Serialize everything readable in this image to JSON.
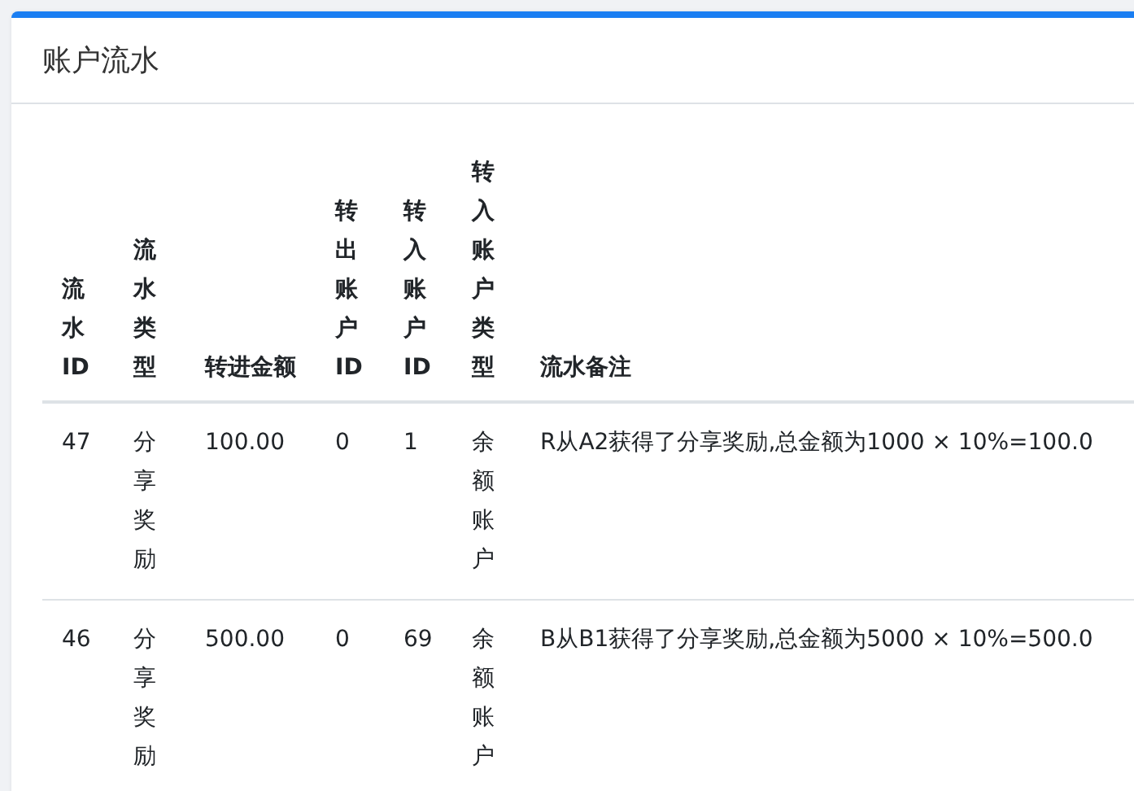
{
  "card": {
    "title": "账户流水"
  },
  "table": {
    "columns": [
      "流水ID",
      "流水类型",
      "转进金额",
      "转出账户ID",
      "转入账户ID",
      "转入账户类型",
      "流水备注"
    ],
    "rows": [
      {
        "cells": [
          "47",
          "分享奖励",
          "100.00",
          "0",
          "1",
          "余额账户",
          "R从A2获得了分享奖励,总金额为1000 × 10%=100.0"
        ]
      },
      {
        "cells": [
          "46",
          "分享奖励",
          "500.00",
          "0",
          "69",
          "余额账户",
          "B从B1获得了分享奖励,总金额为5000 × 10%=500.0"
        ]
      }
    ]
  }
}
